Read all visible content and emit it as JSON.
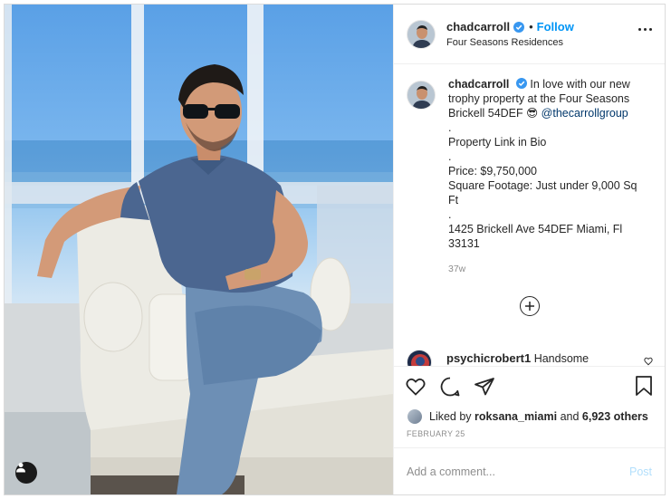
{
  "post": {
    "author": {
      "username": "chadcarroll",
      "verified": true,
      "follow_label": "Follow",
      "dot": "•",
      "location": "Four Seasons Residences"
    },
    "caption": {
      "username": "chadcarroll",
      "lines": [
        "In love with our new trophy property at the Four Seasons Brickell 54DEF 😎",
        ".",
        "Property Link in Bio",
        ".",
        "Price: $9,750,000",
        "Square Footage: Just under 9,000 Sq Ft",
        ".",
        "1425 Brickell Ave 54DEF Miami, Fl 33131"
      ],
      "mention": "@thecarrollgroup",
      "time_ago": "37w"
    },
    "comments": [
      {
        "username": "psychicrobert1",
        "text": "Handsome"
      }
    ],
    "likes": {
      "prefix": "Liked by",
      "user": "roksana_miami",
      "and": "and",
      "others": "6,923 others"
    },
    "date": "FEBRUARY 25",
    "add_comment": {
      "placeholder": "Add a comment...",
      "post_label": "Post"
    },
    "icons": {
      "more": "more-options-icon",
      "like": "heart-icon",
      "comment": "comment-icon",
      "share": "share-icon",
      "save": "bookmark-icon",
      "load_more": "plus-circle-icon",
      "tag": "user-tag-icon"
    },
    "colors": {
      "accent": "#0095f6",
      "verified": "#3897f0",
      "muted": "#8e8e8e",
      "post_disabled": "#b2dffc"
    }
  }
}
